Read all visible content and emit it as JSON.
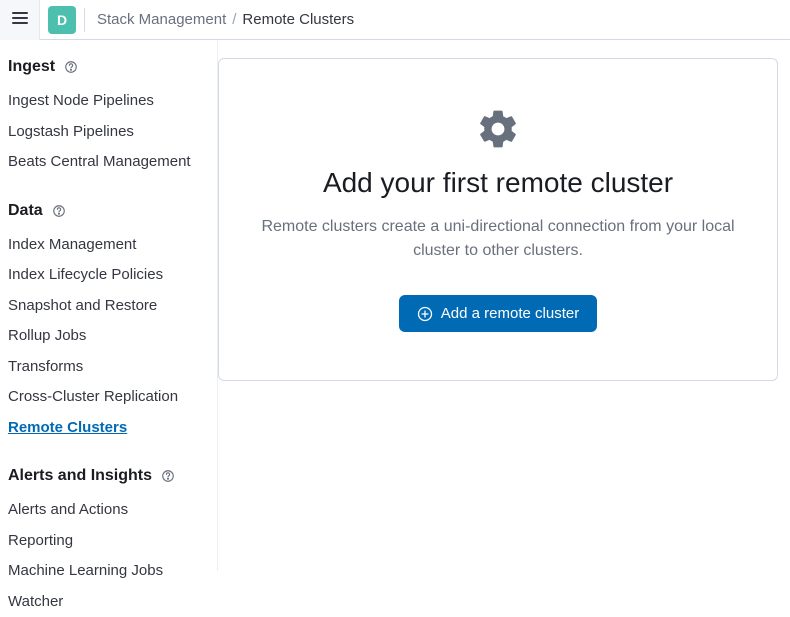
{
  "header": {
    "space_letter": "D",
    "breadcrumb_root": "Stack Management",
    "breadcrumb_current": "Remote Clusters"
  },
  "sidebar": {
    "sections": [
      {
        "title": "Ingest",
        "items": [
          "Ingest Node Pipelines",
          "Logstash Pipelines",
          "Beats Central Management"
        ],
        "active_index": -1
      },
      {
        "title": "Data",
        "items": [
          "Index Management",
          "Index Lifecycle Policies",
          "Snapshot and Restore",
          "Rollup Jobs",
          "Transforms",
          "Cross-Cluster Replication",
          "Remote Clusters"
        ],
        "active_index": 6
      },
      {
        "title": "Alerts and Insights",
        "items": [
          "Alerts and Actions",
          "Reporting",
          "Machine Learning Jobs",
          "Watcher"
        ],
        "active_index": -1
      }
    ]
  },
  "panel": {
    "title": "Add your first remote cluster",
    "description": "Remote clusters create a uni-directional connection from your local cluster to other clusters.",
    "button_label": "Add a remote cluster"
  }
}
